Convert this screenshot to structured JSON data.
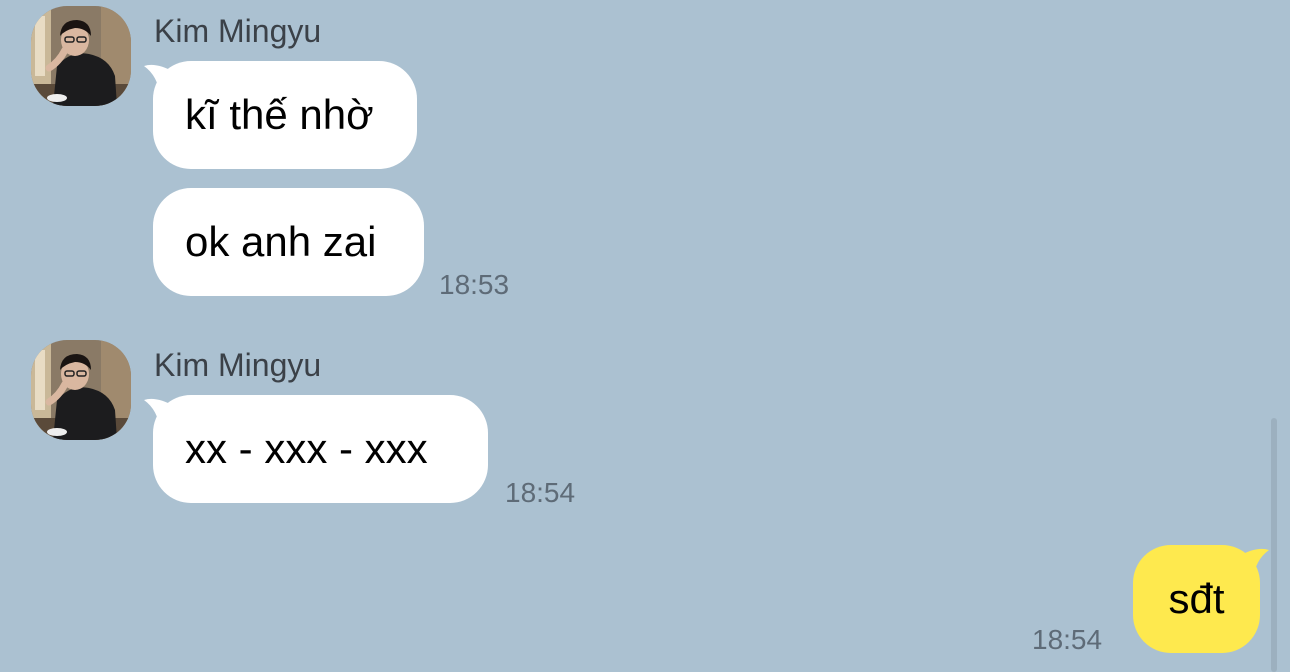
{
  "chat": {
    "groups": [
      {
        "sender": "Kim Mingyu",
        "avatar_icon": "profile-photo-icon",
        "messages": [
          "kĩ thế nhờ",
          "ok anh zai"
        ],
        "time": "18:53"
      },
      {
        "sender": "Kim Mingyu",
        "avatar_icon": "profile-photo-icon",
        "messages": [
          "xx - xxx - xxx"
        ],
        "time": "18:54"
      }
    ],
    "outgoing": {
      "message": "sđt",
      "time": "18:54"
    }
  },
  "colors": {
    "background": "#abc1d1",
    "incoming_bubble": "#ffffff",
    "outgoing_bubble": "#fee94e"
  }
}
